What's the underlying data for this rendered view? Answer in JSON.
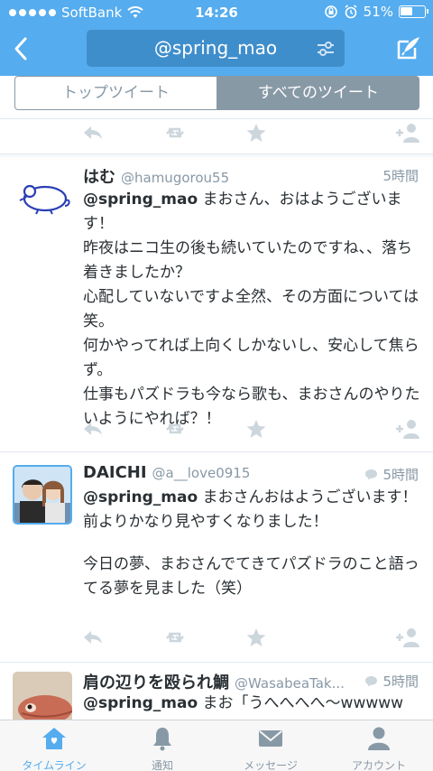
{
  "status": {
    "carrier": "SoftBank",
    "time": "14:26",
    "battery": "51%"
  },
  "header": {
    "title": "@spring_mao"
  },
  "segments": {
    "top": "トップツイート",
    "all": "すべてのツイート"
  },
  "tweets": [
    {
      "name": "はむ",
      "handle": "@hamugorou55",
      "time": "5時間",
      "mention": "@spring_mao",
      "lines": [
        " まおさん、おはようございます！",
        "昨夜はニコ生の後も続いていたのですね、、落ち着きましたか？",
        "心配していないですよ全然、その方面については笑。",
        "何かやってれば上向くしかないし、安心して焦らず。",
        "仕事もパズドラも今なら歌も、まおさんのやりたいようにやれば？！"
      ]
    },
    {
      "name": "DAICHI",
      "handle": "@a__love0915",
      "time": "5時間",
      "mention": "@spring_mao",
      "lines": [
        " まおさんおはようございます！",
        "前よりかなり見やすくなりました！",
        "",
        "今日の夢、まおさんでてきてパズドラのこと語ってる夢を見ました（笑）"
      ]
    },
    {
      "name": "肩の辺りを殴られ鯛",
      "handle": "@WasabeaTak...",
      "time": "5時間",
      "mention": "@spring_mao",
      "lines": [
        " まお「うへへへへ〜wwwww"
      ]
    }
  ],
  "tabs": [
    {
      "label": "タイムライン",
      "icon": "home-icon"
    },
    {
      "label": "通知",
      "icon": "bell-icon"
    },
    {
      "label": "メッセージ",
      "icon": "envelope-icon"
    },
    {
      "label": "アカウント",
      "icon": "person-icon"
    }
  ],
  "colors": {
    "brand": "#55acee",
    "title_box": "#3f8ecc",
    "muted": "#8899a6",
    "text": "#292f33"
  }
}
